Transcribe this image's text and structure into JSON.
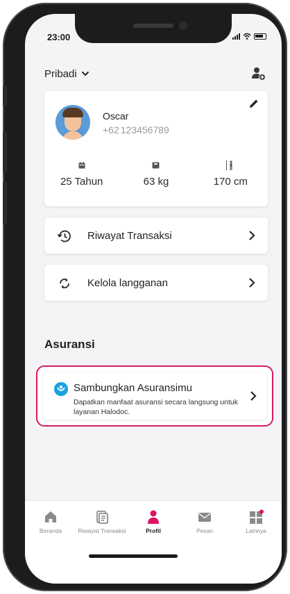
{
  "status_bar": {
    "time": "23:00"
  },
  "header": {
    "account_label": "Pribadi",
    "add_user_icon": "add-user-icon"
  },
  "profile": {
    "name": "Oscar",
    "phone_prefix": "+62",
    "phone_number": "123456789",
    "stats": [
      {
        "icon": "calendar-icon",
        "value": "25 Tahun"
      },
      {
        "icon": "scale-icon",
        "value": "63 kg"
      },
      {
        "icon": "height-icon",
        "value": "170 cm"
      }
    ]
  },
  "menu": {
    "transaction_history": "Riwayat Transaksi",
    "manage_subscription": "Kelola langganan"
  },
  "insurance": {
    "section_title": "Asuransi",
    "card_title": "Sambungkan Asuransimu",
    "card_description": "Dapatkan manfaat asuransi secara langsung untuk layanan Halodoc.",
    "highlight_color": "#d81b60"
  },
  "tabbar": {
    "items": [
      {
        "label": "Beranda",
        "icon": "home-icon"
      },
      {
        "label": "Riwayat Transaksi",
        "icon": "document-icon"
      },
      {
        "label": "Profil",
        "icon": "person-icon"
      },
      {
        "label": "Pesan",
        "icon": "mail-icon"
      },
      {
        "label": "Lainnya",
        "icon": "grid-icon"
      }
    ],
    "active_color": "#e0115f"
  }
}
